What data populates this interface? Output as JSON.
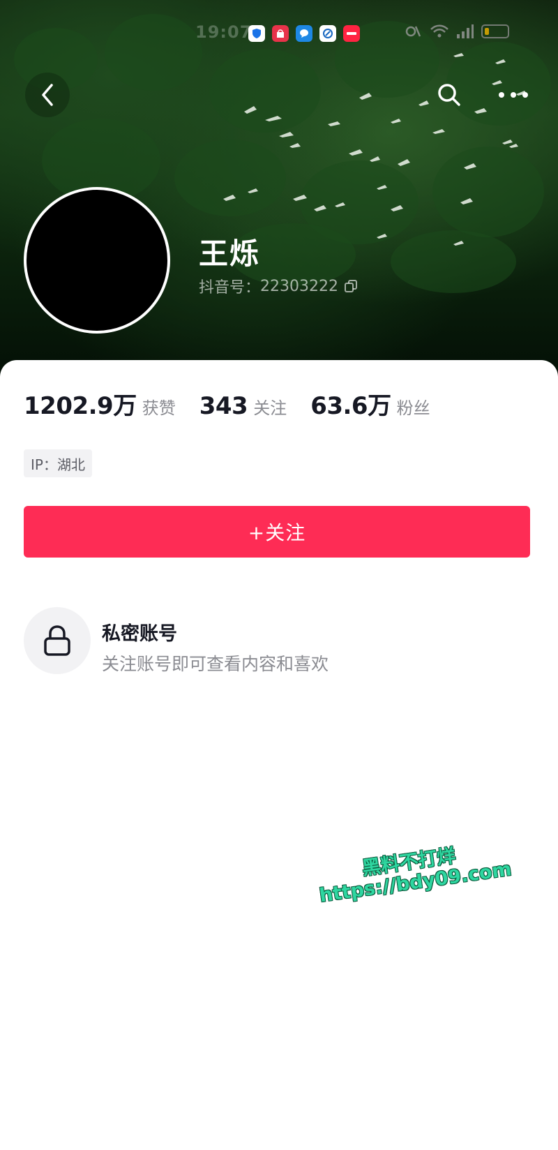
{
  "status_bar": {
    "time": "19:07",
    "notification_icons": [
      "shield-app-icon",
      "shopping-app-icon",
      "message-app-icon",
      "browser-app-icon",
      "xiaohongshu-app-icon"
    ],
    "system_icons": [
      "signal-icon",
      "wifi-icon",
      "cellular-icon",
      "battery-icon"
    ]
  },
  "nav": {
    "back_icon": "chevron-left-icon",
    "search_icon": "search-icon",
    "more_icon": "more-horizontal-icon"
  },
  "profile": {
    "nickname": "王烁",
    "uid_label": "抖音号：",
    "uid_value": "22303222",
    "copy_icon": "copy-icon"
  },
  "stats": [
    {
      "value": "1202.9万",
      "label": "获赞"
    },
    {
      "value": "343",
      "label": "关注"
    },
    {
      "value": "63.6万",
      "label": "粉丝"
    }
  ],
  "ip_tag": "IP：湖北",
  "follow_button": "+关注",
  "private_account": {
    "icon": "lock-icon",
    "title": "私密账号",
    "description": "关注账号即可查看内容和喜欢"
  },
  "watermark": {
    "line1": "黑料不打烊",
    "line2": "https://bdy09.com"
  },
  "colors": {
    "accent": "#fe2c55",
    "text_primary": "#161823",
    "text_secondary": "#8a8b91",
    "watermark": "#2ed6a0"
  }
}
